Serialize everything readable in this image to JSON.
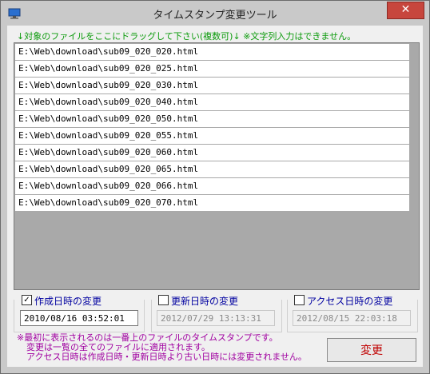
{
  "window": {
    "title": "タイムスタンプ変更ツール",
    "close_label": "✕"
  },
  "instruction": "↓対象のファイルをここにドラッグして下さい(複数可)↓ ※文字列入力はできません。",
  "files": [
    "E:\\Web\\download\\sub09_020_020.html",
    "E:\\Web\\download\\sub09_020_025.html",
    "E:\\Web\\download\\sub09_020_030.html",
    "E:\\Web\\download\\sub09_020_040.html",
    "E:\\Web\\download\\sub09_020_050.html",
    "E:\\Web\\download\\sub09_020_055.html",
    "E:\\Web\\download\\sub09_020_060.html",
    "E:\\Web\\download\\sub09_020_065.html",
    "E:\\Web\\download\\sub09_020_066.html",
    "E:\\Web\\download\\sub09_020_070.html"
  ],
  "created": {
    "label": "作成日時の変更",
    "checked": true,
    "value": "2010/08/16 03:52:01"
  },
  "modified": {
    "label": "更新日時の変更",
    "checked": false,
    "value": "2012/07/29 13:13:31"
  },
  "accessed": {
    "label": "アクセス日時の変更",
    "checked": false,
    "value": "2012/08/15 22:03:18"
  },
  "notes": [
    "※最初に表示されるのは一番上のファイルのタイムスタンプです。",
    "変更は一覧の全てのファイルに適用されます。",
    "アクセス日時は作成日時・更新日時より古い日時には変更されません。"
  ],
  "change_button": "変更",
  "colors": {
    "instruction": "#0a9a0a",
    "checkbox_label": "#0000a0",
    "notes": "#a000a0",
    "change_button_text": "#c00000",
    "close_button": "#c7463d"
  }
}
